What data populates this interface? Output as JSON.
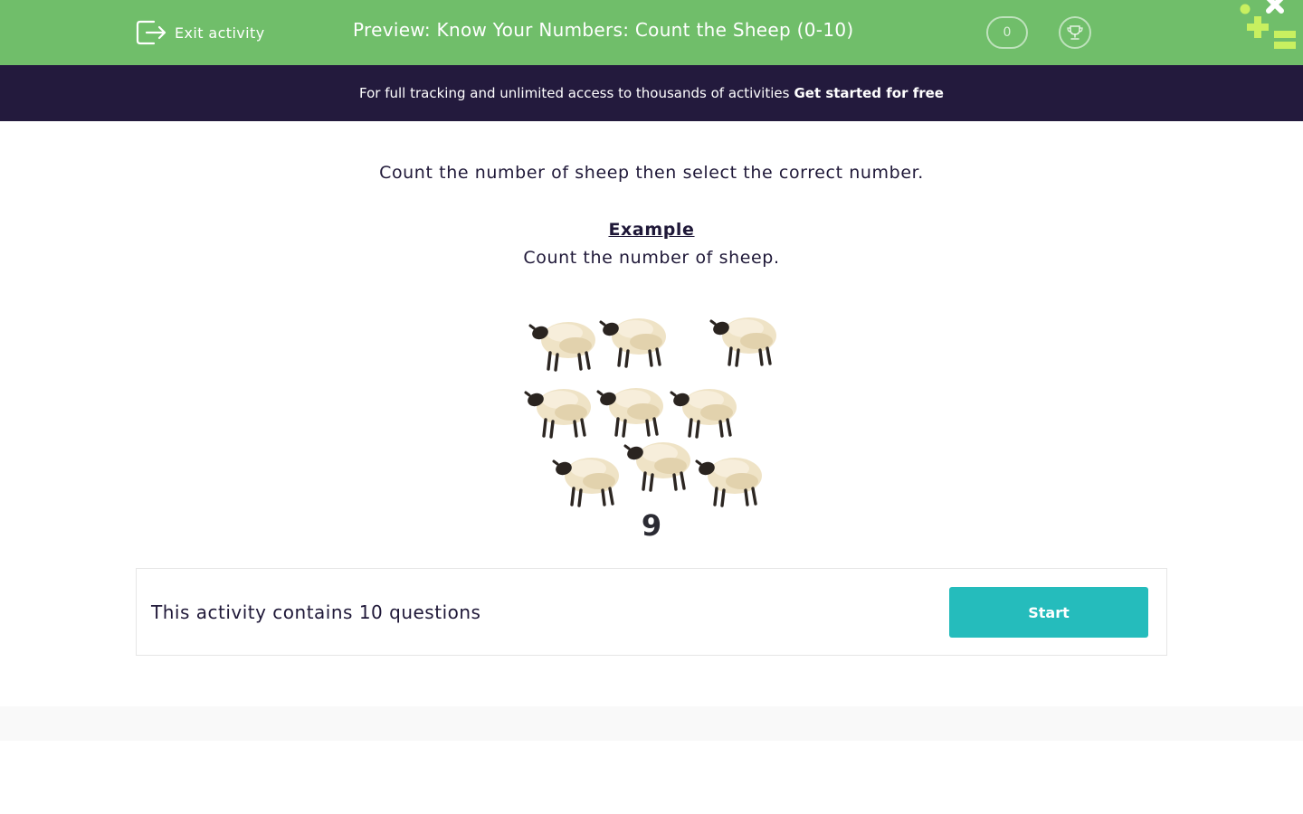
{
  "header": {
    "exit_label": "Exit activity",
    "title": "Preview: Know Your Numbers: Count the Sheep (0-10)",
    "score": "0"
  },
  "banner": {
    "text": "For full tracking and unlimited access to thousands of activities",
    "cta": "Get started for free"
  },
  "content": {
    "instruction": "Count the number of sheep then select the correct number.",
    "example_heading": "Example",
    "example_question": "Count the number of sheep.",
    "sheep_count": 9,
    "answer": "9"
  },
  "card": {
    "text": "This activity contains 10 questions",
    "start_label": "Start"
  },
  "colors": {
    "header_green": "#70be6a",
    "banner_navy": "#231a3d",
    "start_teal": "#25bcbc",
    "logo_lime": "#c8f060"
  },
  "icons": [
    "exit-icon",
    "trophy-icon",
    "logo-icon",
    "sheep-icon"
  ]
}
